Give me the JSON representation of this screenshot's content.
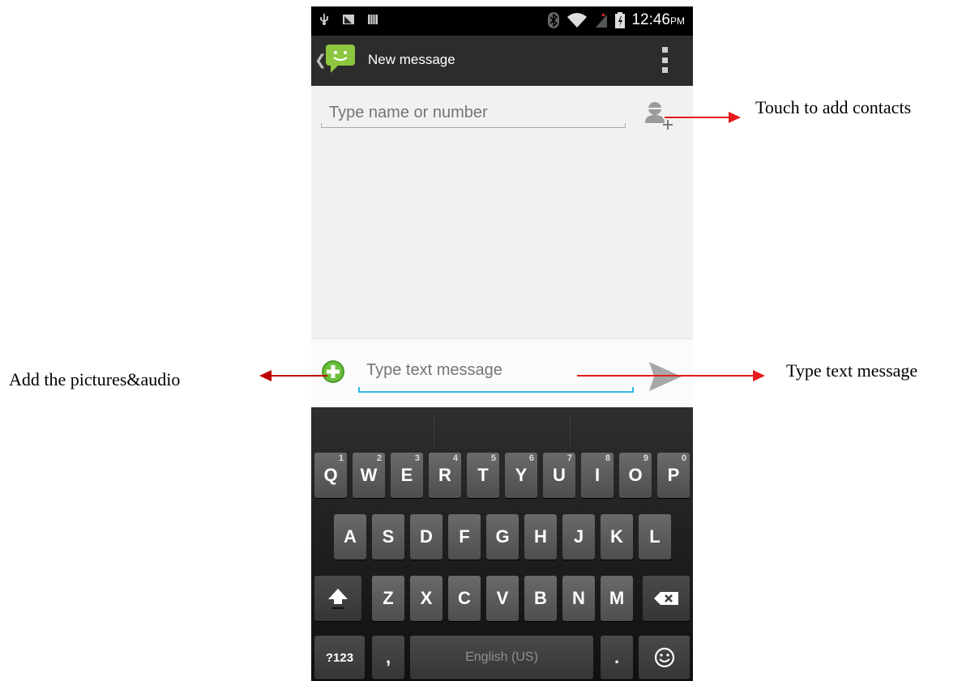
{
  "status_bar": {
    "time": "12:46",
    "ampm": "PM"
  },
  "action_bar": {
    "title": "New message"
  },
  "recipient": {
    "placeholder": "Type name or number"
  },
  "compose": {
    "placeholder": "Type text message"
  },
  "keyboard": {
    "row1": [
      {
        "label": "Q",
        "hint": "1"
      },
      {
        "label": "W",
        "hint": "2"
      },
      {
        "label": "E",
        "hint": "3"
      },
      {
        "label": "R",
        "hint": "4"
      },
      {
        "label": "T",
        "hint": "5"
      },
      {
        "label": "Y",
        "hint": "6"
      },
      {
        "label": "U",
        "hint": "7"
      },
      {
        "label": "I",
        "hint": "8"
      },
      {
        "label": "O",
        "hint": "9"
      },
      {
        "label": "P",
        "hint": "0"
      }
    ],
    "row2": [
      "A",
      "S",
      "D",
      "F",
      "G",
      "H",
      "J",
      "K",
      "L"
    ],
    "row3": [
      "Z",
      "X",
      "C",
      "V",
      "B",
      "N",
      "M"
    ],
    "symbols_label": "?123",
    "comma_label": ",",
    "space_label": "English (US)",
    "period_label": "."
  },
  "annotations": {
    "contacts": "Touch to add contacts",
    "attach": "Add the pictures&audio",
    "message": "Type text message"
  },
  "colors": {
    "accent": "#33b5e5",
    "arrow": "#e31b1b",
    "attach_green": "#5fae35"
  }
}
